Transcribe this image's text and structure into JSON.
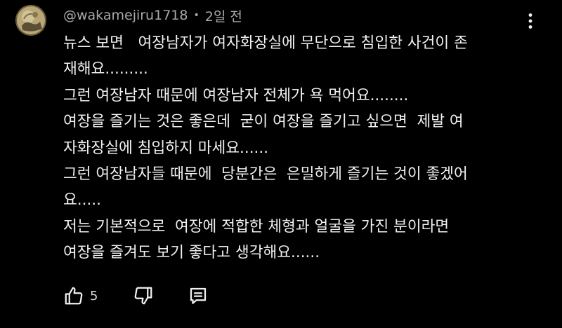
{
  "comment": {
    "author": "@wakamejiru1718",
    "time": "2일 전",
    "lines": [
      "뉴스 보면   여장남자가 여자화장실에 무단으로 침입한 사건이 존",
      "재해요.........",
      "그런 여장남자 때문에 여장남자 전체가 욕 먹어요........",
      "여장을 즐기는 것은 좋은데  굳이 여장을 즐기고 싶으면  제발 여",
      "자화장실에 침입하지 마세요......",
      "그런 여장남자들 때문에  당분간은  은밀하게 즐기는 것이 좋겠어",
      "요.....",
      "저는 기본적으로  여장에 적합한 체형과 얼굴을 가진 분이라면",
      "여장을 즐겨도 보기 좋다고 생각해요......"
    ]
  },
  "actions": {
    "like_count": "5",
    "icons": {
      "like": "thumbs-up-icon",
      "dislike": "thumbs-down-icon",
      "reply": "comment-icon",
      "menu": "more-vertical-icon"
    }
  },
  "colors": {
    "background": "#000000",
    "text": "#f1f1f1",
    "secondary_text": "#aaaaaa"
  }
}
